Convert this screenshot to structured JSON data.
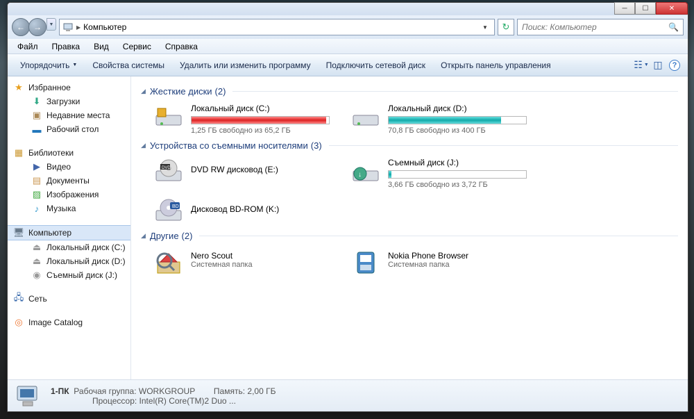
{
  "title_controls": {
    "min": "_",
    "max": "☐",
    "close": "✕"
  },
  "nav": {
    "location": "Компьютер"
  },
  "search": {
    "placeholder": "Поиск: Компьютер"
  },
  "menu": [
    "Файл",
    "Правка",
    "Вид",
    "Сервис",
    "Справка"
  ],
  "toolbar": {
    "organize": "Упорядочить",
    "sys_props": "Свойства системы",
    "uninstall": "Удалить или изменить программу",
    "map_drive": "Подключить сетевой диск",
    "control_panel": "Открыть панель управления"
  },
  "sidebar": {
    "favorites": {
      "label": "Избранное",
      "items": [
        "Загрузки",
        "Недавние места",
        "Рабочий стол"
      ]
    },
    "libraries": {
      "label": "Библиотеки",
      "items": [
        "Видео",
        "Документы",
        "Изображения",
        "Музыка"
      ]
    },
    "computer": {
      "label": "Компьютер",
      "items": [
        "Локальный диск (C:)",
        "Локальный диск (D:)",
        "Съемный диск (J:)"
      ]
    },
    "network": {
      "label": "Сеть"
    },
    "image_catalog": {
      "label": "Image Catalog"
    }
  },
  "groups": {
    "hdd": {
      "title": "Жесткие диски",
      "count": "(2)"
    },
    "removable": {
      "title": "Устройства со съемными носителями",
      "count": "(3)"
    },
    "other": {
      "title": "Другие",
      "count": "(2)"
    }
  },
  "drives": {
    "c": {
      "name": "Локальный диск (C:)",
      "free": "1,25 ГБ свободно из 65,2 ГБ",
      "fill": 98,
      "color": "red"
    },
    "d": {
      "name": "Локальный диск (D:)",
      "free": "70,8 ГБ свободно из 400 ГБ",
      "fill": 82,
      "color": "teal"
    },
    "dvd": {
      "name": "DVD RW дисковод (E:)"
    },
    "j": {
      "name": "Съемный диск (J:)",
      "free": "3,66 ГБ свободно из 3,72 ГБ",
      "fill": 2,
      "color": "teal"
    },
    "bd": {
      "name": "Дисковод BD-ROM (K:)"
    }
  },
  "other_items": {
    "nero": {
      "name": "Nero Scout",
      "type": "Системная папка"
    },
    "nokia": {
      "name": "Nokia Phone Browser",
      "type": "Системная папка"
    }
  },
  "status": {
    "pc": "1-ПК",
    "wg_label": "Рабочая группа:",
    "wg": "WORKGROUP",
    "mem_label": "Память:",
    "mem": "2,00 ГБ",
    "cpu_label": "Процессор:",
    "cpu": "Intel(R) Core(TM)2 Duo ..."
  }
}
